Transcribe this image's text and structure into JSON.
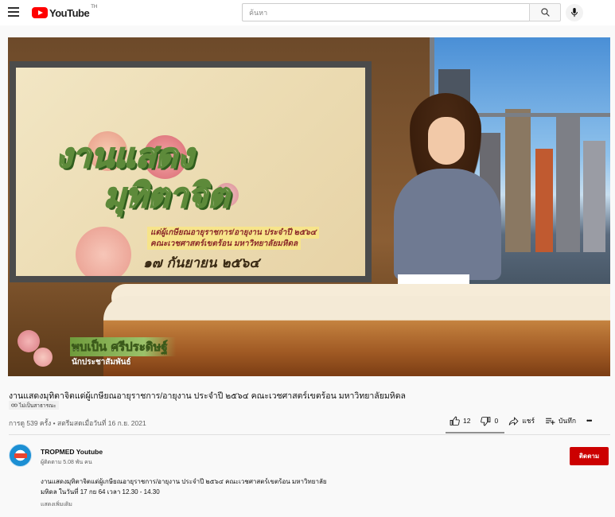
{
  "header": {
    "logo_text": "YouTube",
    "logo_region": "TH",
    "search_placeholder": "ค้นหา"
  },
  "video": {
    "overlay_title_line1": "งานแสดง",
    "overlay_title_line2": "มุทิตาจิต",
    "overlay_subtitle_line1": "แด่ผู้เกษียณอายุราชการ/อายุงาน ประจำปี ๒๕๖๔",
    "overlay_subtitle_line2": "คณะเวชศาสตร์เขตร้อน มหาวิทยาลัยมหิดล",
    "overlay_date": "๑๗ กันยายน ๒๕๖๔",
    "presenter_name": "พบเป็น ศรีประดิษฐ์",
    "presenter_role": "นักประชาสัมพันธ์"
  },
  "info": {
    "title": "งานแสดงมุทิตาจิตแด่ผู้เกษียณอายุราชการ/อายุงาน ประจำปี ๒๕๖๔ คณะเวชศาสตร์เขตร้อน มหาวิทยาลัยมหิดล",
    "badge": "ไม่เป็นสาธารณะ",
    "meta": "การดู 539 ครั้ง • สตรีมสดเมื่อวันที่ 16 ก.ย. 2021",
    "likes": "12",
    "dislikes": "0",
    "share_label": "แชร์",
    "save_label": "บันทึก",
    "more_label": "•••"
  },
  "channel": {
    "name": "TROPMED Youtube",
    "subscribers": "ผู้ติดตาม 5.08 พัน คน",
    "subscribe_label": "ติดตาม"
  },
  "description": {
    "line1": "งานแสดงมุทิตาจิตแด่ผู้เกษียณอายุราชการ/อายุงาน ประจำปี ๒๕๖๔ คณะเวชศาสตร์เขตร้อน มหาวิทยาลัย",
    "line2": "มหิดล ในวันที่ 17 กย 64 เวลา 12.30 - 14.30",
    "show_more": "แสดงเพิ่มเติม"
  },
  "colors": {
    "brand_red": "#ff0000",
    "subscribe_red": "#cc0000"
  }
}
